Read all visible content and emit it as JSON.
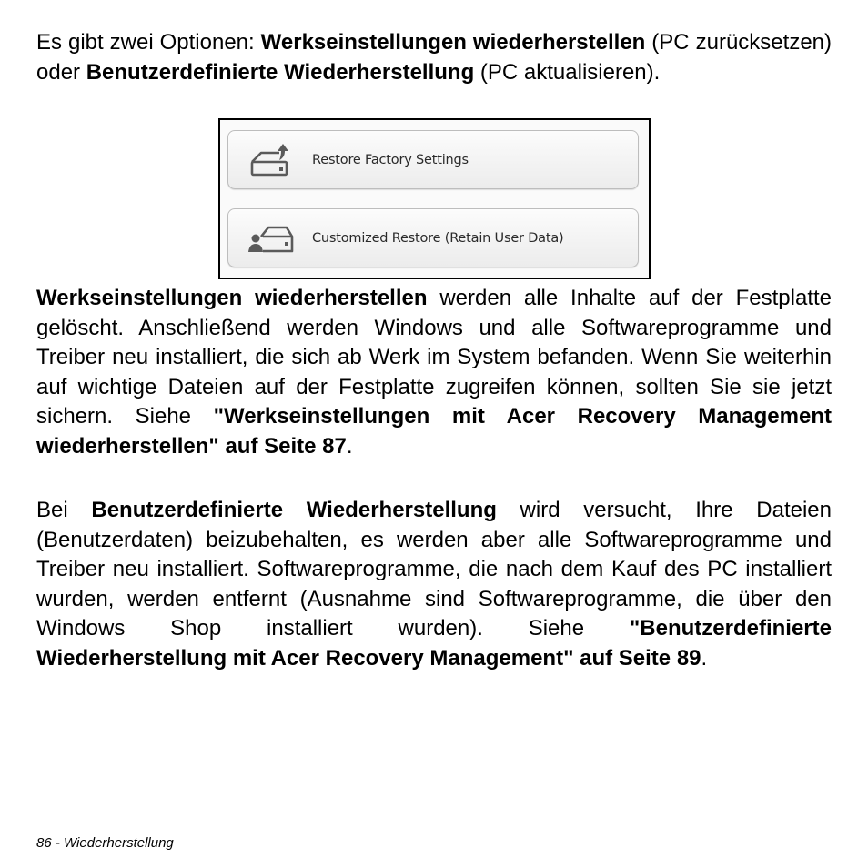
{
  "paragraphs": {
    "intro": {
      "t1": "Es gibt zwei Optionen: ",
      "b1": "Werkseinstellungen wiederherstellen",
      "t2": " (PC zurücksetzen) oder ",
      "b2": "Benutzerdefinierte Wiederherstellung",
      "t3": " (PC aktualisieren)."
    },
    "factory": {
      "b1": "Werkseinstellungen wiederherstellen",
      "t1": " werden alle Inhalte auf der Festplatte gelöscht. Anschließend werden Windows und alle Softwareprogramme und Treiber neu installiert, die sich ab Werk im System befanden. Wenn Sie weiterhin auf wichtige Dateien auf der Festplatte zugreifen können, sollten Sie sie jetzt sichern. Siehe ",
      "b2": "\"Werkseinstellungen mit Acer Recovery Management wiederherstellen\" auf Seite 87",
      "t2": "."
    },
    "custom": {
      "t1": "Bei ",
      "b1": "Benutzerdefinierte Wiederherstellung",
      "t2": " wird versucht, Ihre Dateien (Benutzerdaten) beizubehalten, es werden aber alle Softwareprogramme und Treiber neu installiert. Softwareprogramme, die nach dem Kauf des PC installiert wurden, werden entfernt (Ausnahme sind Softwareprogramme, die über den Windows Shop installiert wurden). Siehe ",
      "b2": "\"Benutzerdefinierte Wiederherstellung mit Acer Recovery Management\" auf Seite 89",
      "t3": "."
    }
  },
  "figure": {
    "buttons": [
      {
        "label": "Restore Factory Settings",
        "icon": "drive-upload-icon"
      },
      {
        "label": "Customized Restore (Retain User Data)",
        "icon": "drive-user-icon"
      }
    ],
    "icon_color": "#5a5a5a"
  },
  "footer": {
    "page_label": "86 - Wiederherstellung"
  }
}
